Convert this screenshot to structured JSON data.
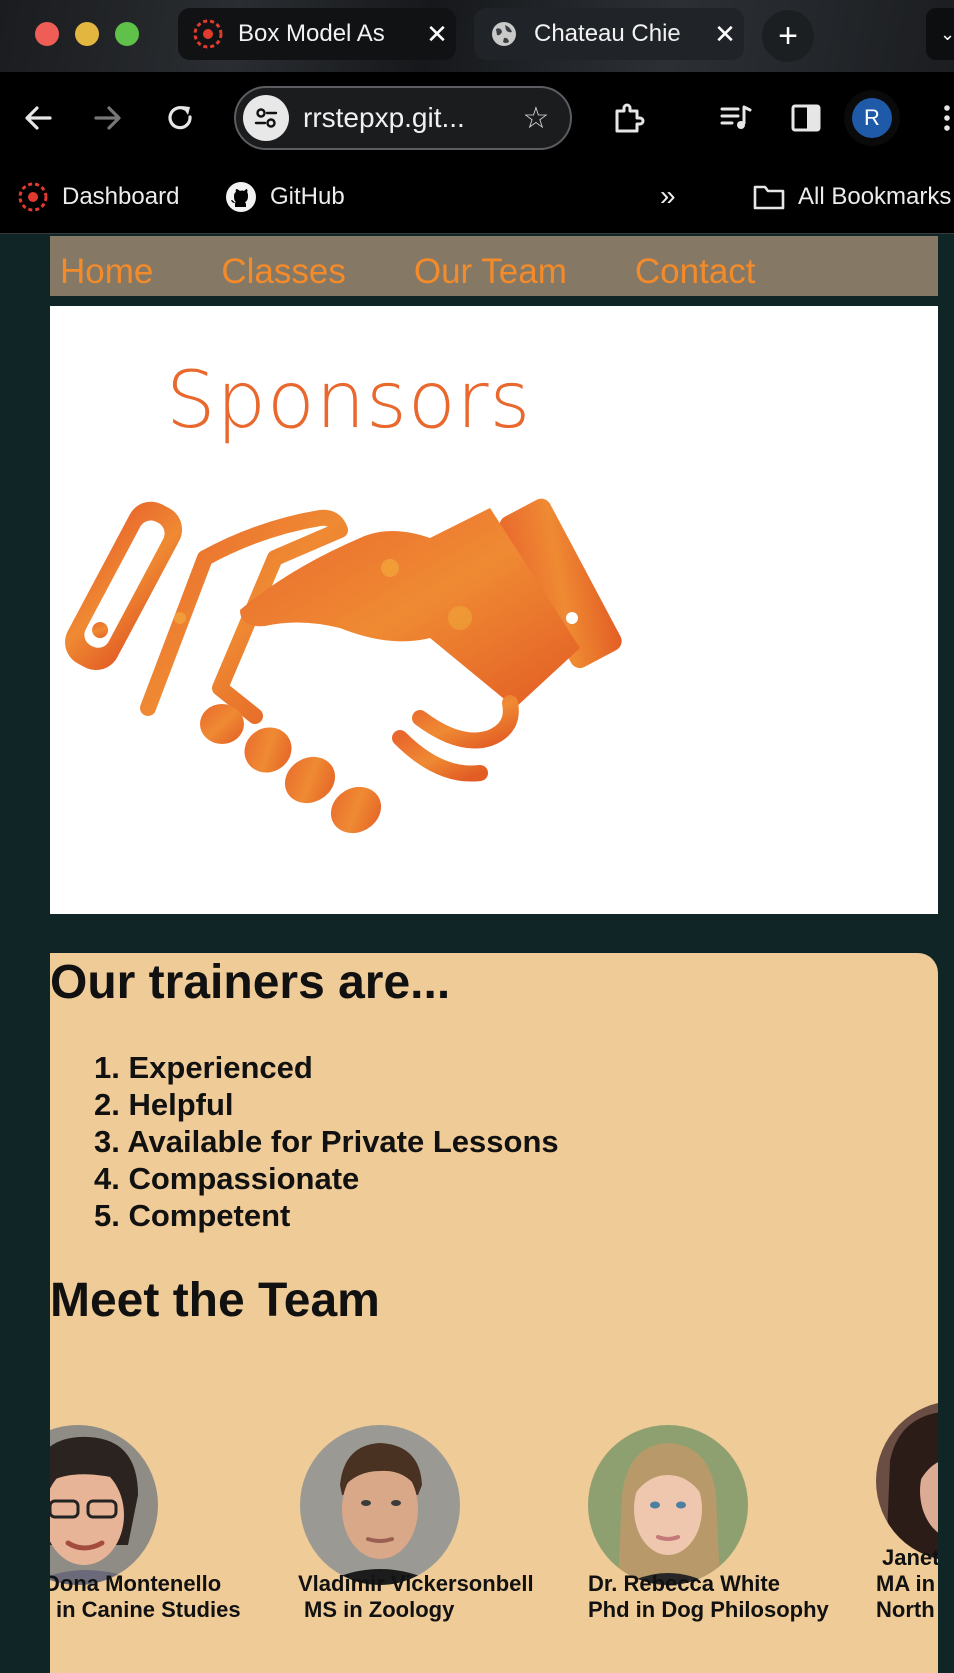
{
  "browser": {
    "tabs": [
      {
        "title": "Box Model As",
        "favicon": "canvas-logo-icon",
        "active": false
      },
      {
        "title": "Chateau Chie",
        "favicon": "globe-icon",
        "active": true
      }
    ],
    "address": "rrstepxp.git...",
    "profile_initial": "R",
    "bookmarks": [
      {
        "label": "Dashboard",
        "icon": "canvas-logo-icon"
      },
      {
        "label": "GitHub",
        "icon": "github-icon"
      }
    ],
    "all_bookmarks": "All Bookmarks"
  },
  "nav": {
    "items": [
      "Home",
      "Classes",
      "Our Team",
      "Contact"
    ],
    "color": "#f38b2a",
    "background": "#857865"
  },
  "sponsors": {
    "title": "Sponsors",
    "image": "handshake-icon",
    "accent": "#e9682d"
  },
  "trainers": {
    "heading": "Our trainers are...",
    "qualities": [
      "1. Experienced",
      "2. Helpful",
      "3. Available for Private Lessons",
      "4. Compassionate",
      "5. Competent"
    ]
  },
  "team": {
    "heading": "Meet the Team",
    "members": [
      {
        "name": "Dona Montenello",
        "degree": "in Canine Studies"
      },
      {
        "name": "Vladimir Vickersonbell",
        "degree": "MS in Zoology"
      },
      {
        "name": "Dr. Rebecca White",
        "degree": "Phd in Dog Philosophy"
      },
      {
        "name": "Janet",
        "degree": "MA in",
        "degree2": "North"
      }
    ]
  }
}
